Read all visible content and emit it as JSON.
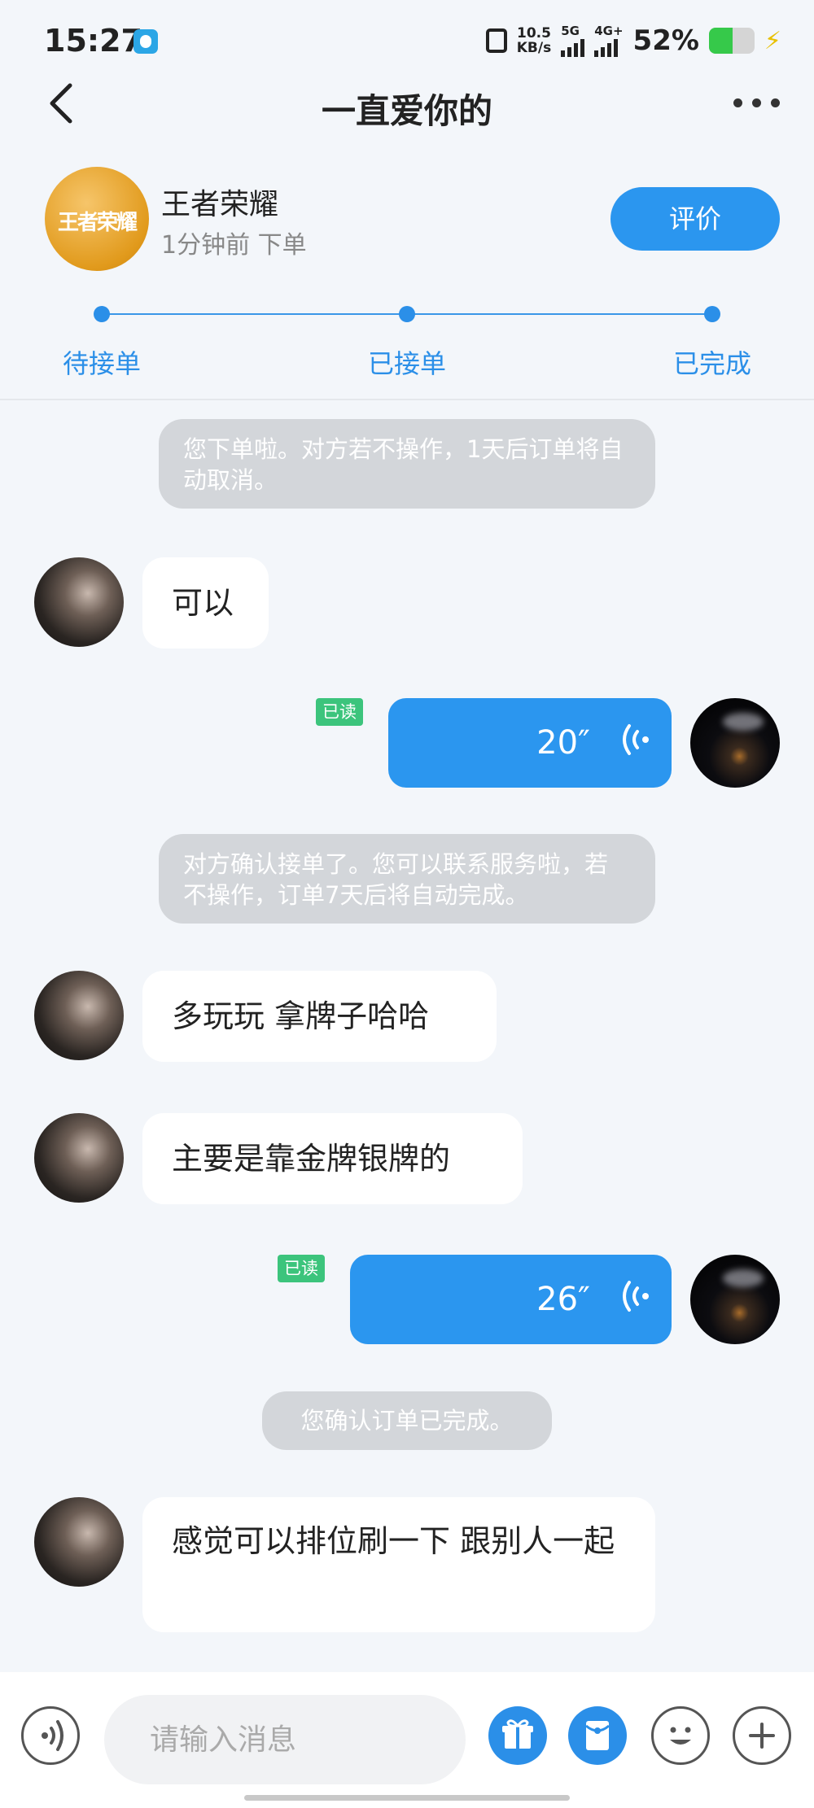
{
  "status_bar": {
    "time": "15:27",
    "net_speed_value": "10.5",
    "net_speed_unit": "KB/s",
    "signal1_label": "5G",
    "signal2_label": "4G+",
    "battery_percent": "52%",
    "battery_level": 0.52
  },
  "header": {
    "title": "一直爱你的"
  },
  "order": {
    "game_logo_text": "王者荣耀",
    "game_name": "王者荣耀",
    "order_time": "1分钟前 下单",
    "rate_label": "评价"
  },
  "progress": {
    "steps": [
      {
        "label": "待接单"
      },
      {
        "label": "已接单"
      },
      {
        "label": "已完成"
      }
    ]
  },
  "chat": {
    "sys1": "您下单啦。对方若不操作，1天后订单将自动取消。",
    "msg1": "可以",
    "voice1": {
      "read": "已读",
      "duration": "20″"
    },
    "sys2": "对方确认接单了。您可以联系服务啦，若不操作，订单7天后将自动完成。",
    "msg2": "多玩玩 拿牌子哈哈",
    "msg3": "主要是靠金牌银牌的",
    "voice2": {
      "read": "已读",
      "duration": "26″"
    },
    "sys3": "您确认订单已完成。",
    "msg4": "感觉可以排位刷一下 跟别人一起"
  },
  "input": {
    "placeholder": "请输入消息"
  },
  "colors": {
    "accent": "#2b96ef",
    "read_badge": "#3cc47c",
    "system_note": "#d3d6da",
    "background": "#f3f6fa"
  }
}
